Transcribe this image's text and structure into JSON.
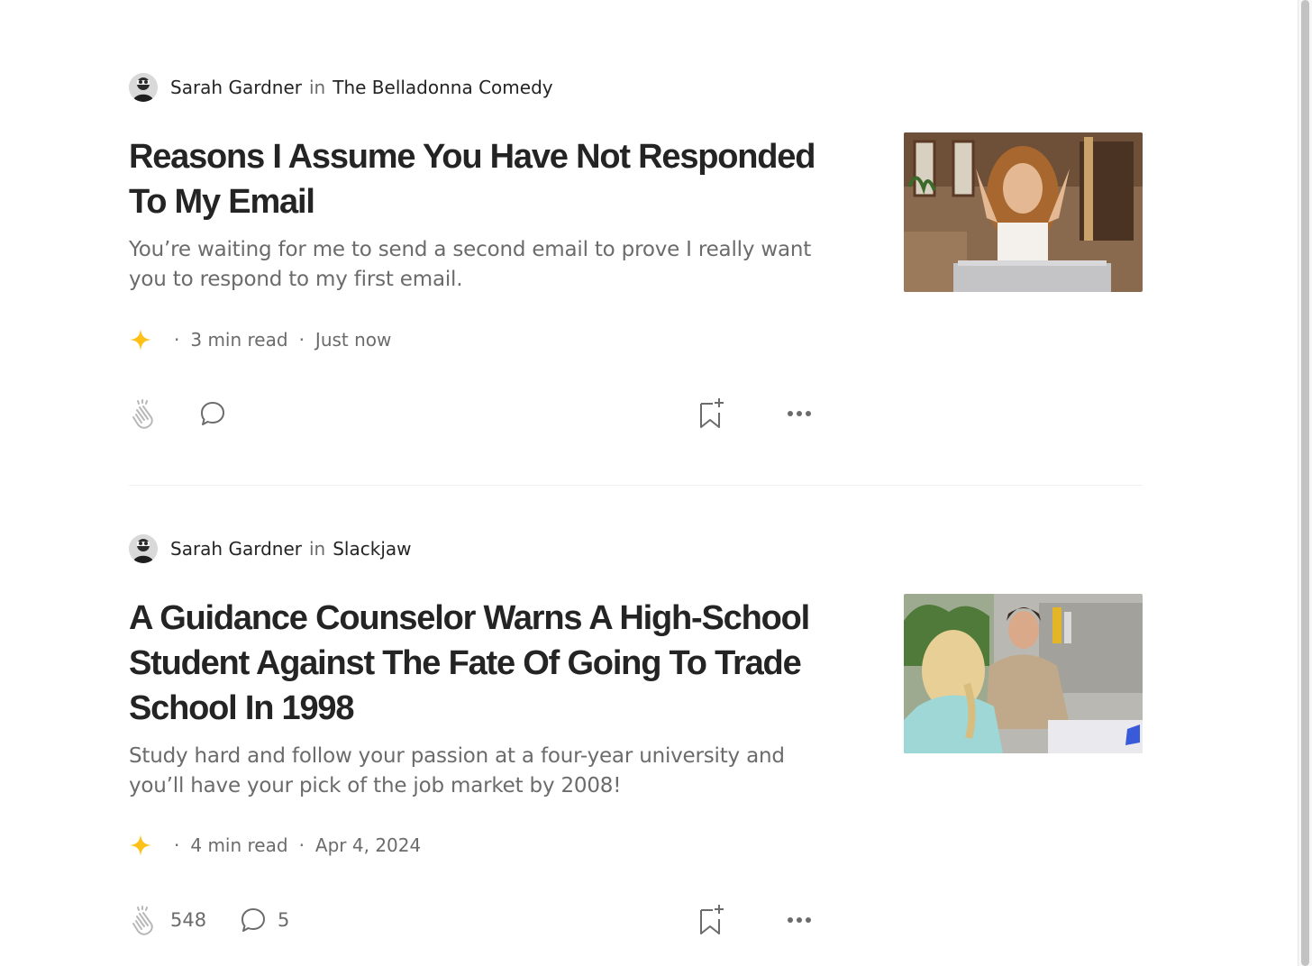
{
  "articles": [
    {
      "author": "Sarah Gardner",
      "in_word": "in",
      "publication": "The Belladonna Comedy",
      "title": "Reasons I Assume You Have Not Responded To My Email",
      "subtitle": "You’re waiting for me to send a second email to prove I really want you to respond to my first email.",
      "read_time": "3 min read",
      "date": "Just now",
      "claps": "",
      "responses": "",
      "icons": [
        "star-icon",
        "clap-icon",
        "comment-icon",
        "bookmark-add-icon",
        "more-icon"
      ]
    },
    {
      "author": "Sarah Gardner",
      "in_word": "in",
      "publication": "Slackjaw",
      "title": "A Guidance Counselor Warns A High-School Student Against The Fate Of Going To Trade School In 1998",
      "subtitle": "Study hard and follow your passion at a four-year university and you’ll have your pick of the job market by 2008!",
      "read_time": "4 min read",
      "date": "Apr 4, 2024",
      "claps": "548",
      "responses": "5",
      "icons": [
        "star-icon",
        "clap-icon",
        "comment-icon",
        "bookmark-add-icon",
        "more-icon"
      ]
    }
  ],
  "separator": "·",
  "colors": {
    "star": "#FFC017",
    "text": "#242424",
    "muted": "#6B6B6B",
    "divider": "#F0F0F0"
  }
}
